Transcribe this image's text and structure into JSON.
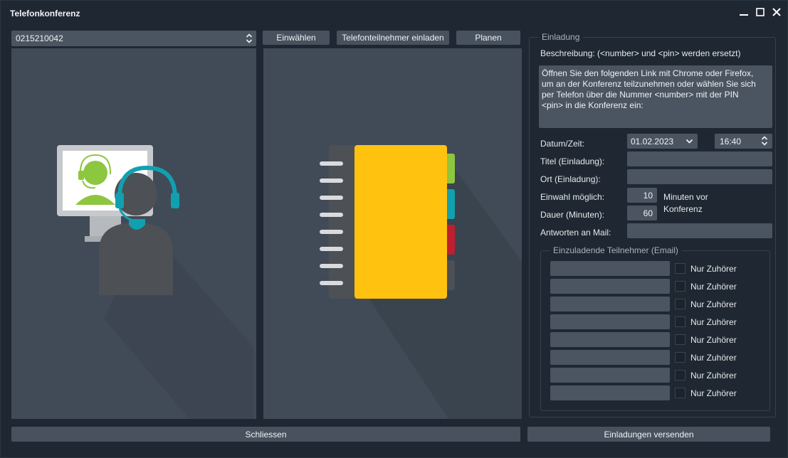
{
  "window": {
    "title": "Telefonkonferenz"
  },
  "toolbar": {
    "phone_number": "0215210042",
    "dial_in": "Einwählen",
    "invite_phone": "Telefonteilnehmer einladen",
    "plan": "Planen"
  },
  "invitation": {
    "group_title": "Einladung",
    "description_label": "Beschreibung: (<number> und <pin> werden ersetzt)",
    "description_text": "Öffnen Sie den folgenden Link mit Chrome oder Firefox,\num an der Konferenz teilzunehmen oder wählen Sie sich\nper Telefon über die Nummer <number> mit der PIN\n<pin> in die Konferenz ein:",
    "datetime_label": "Datum/Zeit:",
    "date_value": "01.02.2023",
    "time_value": "16:40",
    "title_label": "Titel (Einladung):",
    "title_value": "",
    "location_label": "Ort (Einladung):",
    "location_value": "",
    "dialin_label": "Einwahl möglich:",
    "dialin_value": "10",
    "minutes_before": "Minuten vor",
    "conference": "Konferenz",
    "duration_label": "Dauer (Minuten):",
    "duration_value": "60",
    "reply_label": "Antworten an Mail:",
    "reply_value": ""
  },
  "participants": {
    "group_title": "Einzuladende Teilnehmer (Email)",
    "listener_label": "Nur Zuhörer",
    "rows": 8
  },
  "footer": {
    "close": "Schliessen",
    "send": "Einladungen versenden"
  },
  "colors": {
    "accent_green": "#8dc63f",
    "accent_teal": "#11a0b0",
    "accent_red": "#be1e2d",
    "notebook_yellow": "#ffc20e"
  }
}
